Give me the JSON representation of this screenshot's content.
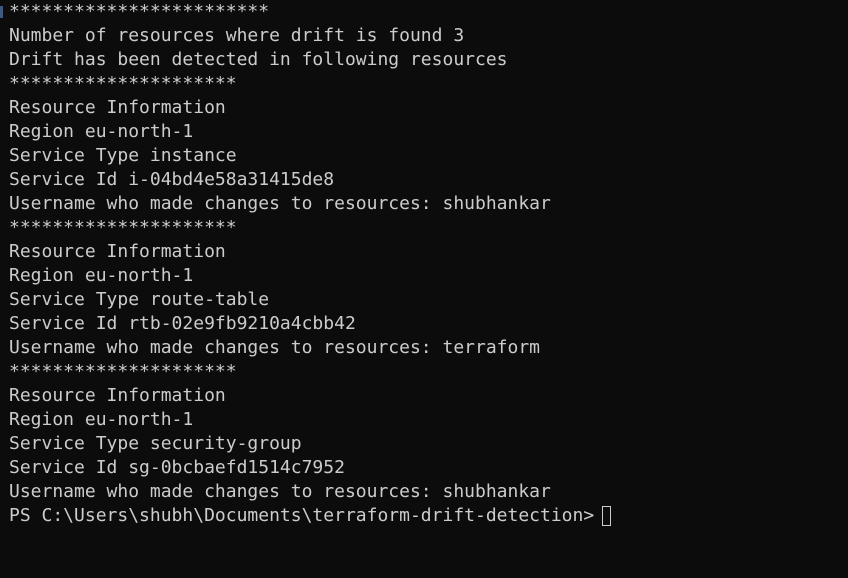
{
  "terminal": {
    "colors": {
      "background": "#0c0c0c",
      "foreground": "#cccccc"
    },
    "lines": [
      "************************",
      "Number of resources where drift is found 3",
      "Drift has been detected in following resources",
      "*********************",
      "Resource Information",
      "Region eu-north-1",
      "Service Type instance",
      "Service Id i-04bd4e58a31415de8",
      "Username who made changes to resources: shubhankar",
      "*********************",
      "Resource Information",
      "Region eu-north-1",
      "Service Type route-table",
      "Service Id rtb-02e9fb9210a4cbb42",
      "Username who made changes to resources: terraform",
      "*********************",
      "Resource Information",
      "Region eu-north-1",
      "Service Type security-group",
      "Service Id sg-0bcbaefd1514c7952",
      "Username who made changes to resources: shubhankar"
    ],
    "prompt": "PS C:\\Users\\shubh\\Documents\\terraform-drift-detection>"
  }
}
